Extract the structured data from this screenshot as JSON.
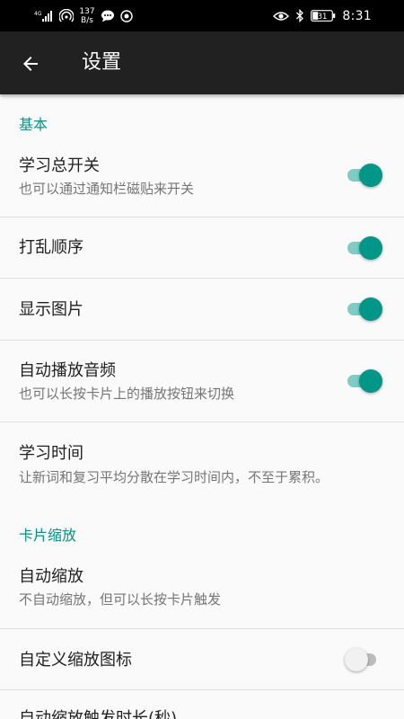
{
  "status_bar": {
    "net_speed_value": "137",
    "net_speed_unit": "B/s",
    "battery": "31",
    "time": "8:31"
  },
  "toolbar": {
    "title": "设置"
  },
  "sections": {
    "basic": {
      "header": "基本",
      "items": [
        {
          "title": "学习总开关",
          "summary": "也可以通过通知栏磁贴来开关",
          "checked": true
        },
        {
          "title": "打乱顺序",
          "checked": true
        },
        {
          "title": "显示图片",
          "checked": true
        },
        {
          "title": "自动播放音频",
          "summary": "也可以长按卡片上的播放按钮来切换",
          "checked": true
        },
        {
          "title": "学习时间",
          "summary": "让新词和复习平均分散在学习时间内，不至于累积。"
        }
      ]
    },
    "zoom": {
      "header": "卡片缩放",
      "items": [
        {
          "title": "自动缩放",
          "summary": "不自动缩放，但可以长按卡片触发"
        },
        {
          "title": "自定义缩放图标",
          "checked": false
        },
        {
          "title": "自动缩放触发时长(秒)"
        }
      ]
    }
  },
  "colors": {
    "accent": "#009688",
    "toolbar": "#212121",
    "status_bar": "#000000"
  }
}
